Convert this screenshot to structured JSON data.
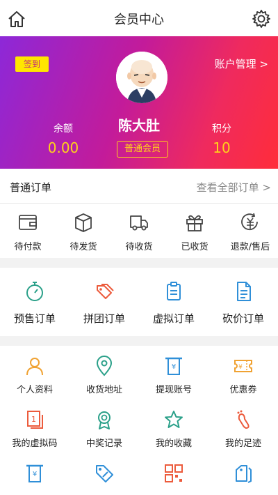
{
  "header": {
    "title": "会员中心",
    "home_icon": "home-icon",
    "settings_icon": "gear-icon"
  },
  "profile": {
    "checkin_label": "签到",
    "account_label": "账户管理 >",
    "name": "陈大肚",
    "level": "普通会员",
    "balance_label": "余额",
    "balance_value": "0.00",
    "points_label": "积分",
    "points_value": "10"
  },
  "orders": {
    "title": "普通订单",
    "view_all": "查看全部订单 >",
    "items": [
      {
        "label": "待付款",
        "icon": "wallet-icon"
      },
      {
        "label": "待发货",
        "icon": "box-icon"
      },
      {
        "label": "待收货",
        "icon": "truck-icon"
      },
      {
        "label": "已收货",
        "icon": "gift-icon"
      },
      {
        "label": "退款/售后",
        "icon": "refund-icon"
      }
    ]
  },
  "order_types": [
    {
      "label": "预售订单",
      "icon": "stopwatch-icon",
      "color": "#2aa089"
    },
    {
      "label": "拼团订单",
      "icon": "tag-group-icon",
      "color": "#ec5b3c"
    },
    {
      "label": "虚拟订单",
      "icon": "clipboard-icon",
      "color": "#2f8fd8"
    },
    {
      "label": "砍价订单",
      "icon": "document-icon",
      "color": "#2f8fd8"
    }
  ],
  "tools": [
    {
      "label": "个人资料",
      "icon": "person-icon",
      "color": "#f0a232"
    },
    {
      "label": "收货地址",
      "icon": "location-pin-icon",
      "color": "#2aa089"
    },
    {
      "label": "提现账号",
      "icon": "atm-icon",
      "color": "#2f8fd8"
    },
    {
      "label": "优惠券",
      "icon": "coupon-icon",
      "color": "#f0a232"
    },
    {
      "label": "我的虚拟码",
      "icon": "code-card-icon",
      "color": "#ec5b3c"
    },
    {
      "label": "中奖记录",
      "icon": "medal-icon",
      "color": "#2aa089"
    },
    {
      "label": "我的收藏",
      "icon": "star-icon",
      "color": "#2aa089"
    },
    {
      "label": "我的足迹",
      "icon": "footprint-icon",
      "color": "#ec5b3c"
    },
    {
      "label": "",
      "icon": "atm-icon",
      "color": "#2f8fd8"
    },
    {
      "label": "",
      "icon": "price-tag-icon",
      "color": "#2f8fd8"
    },
    {
      "label": "",
      "icon": "qr-icon",
      "color": "#ec5b3c"
    },
    {
      "label": "",
      "icon": "tags-icon",
      "color": "#2f8fd8"
    }
  ]
}
